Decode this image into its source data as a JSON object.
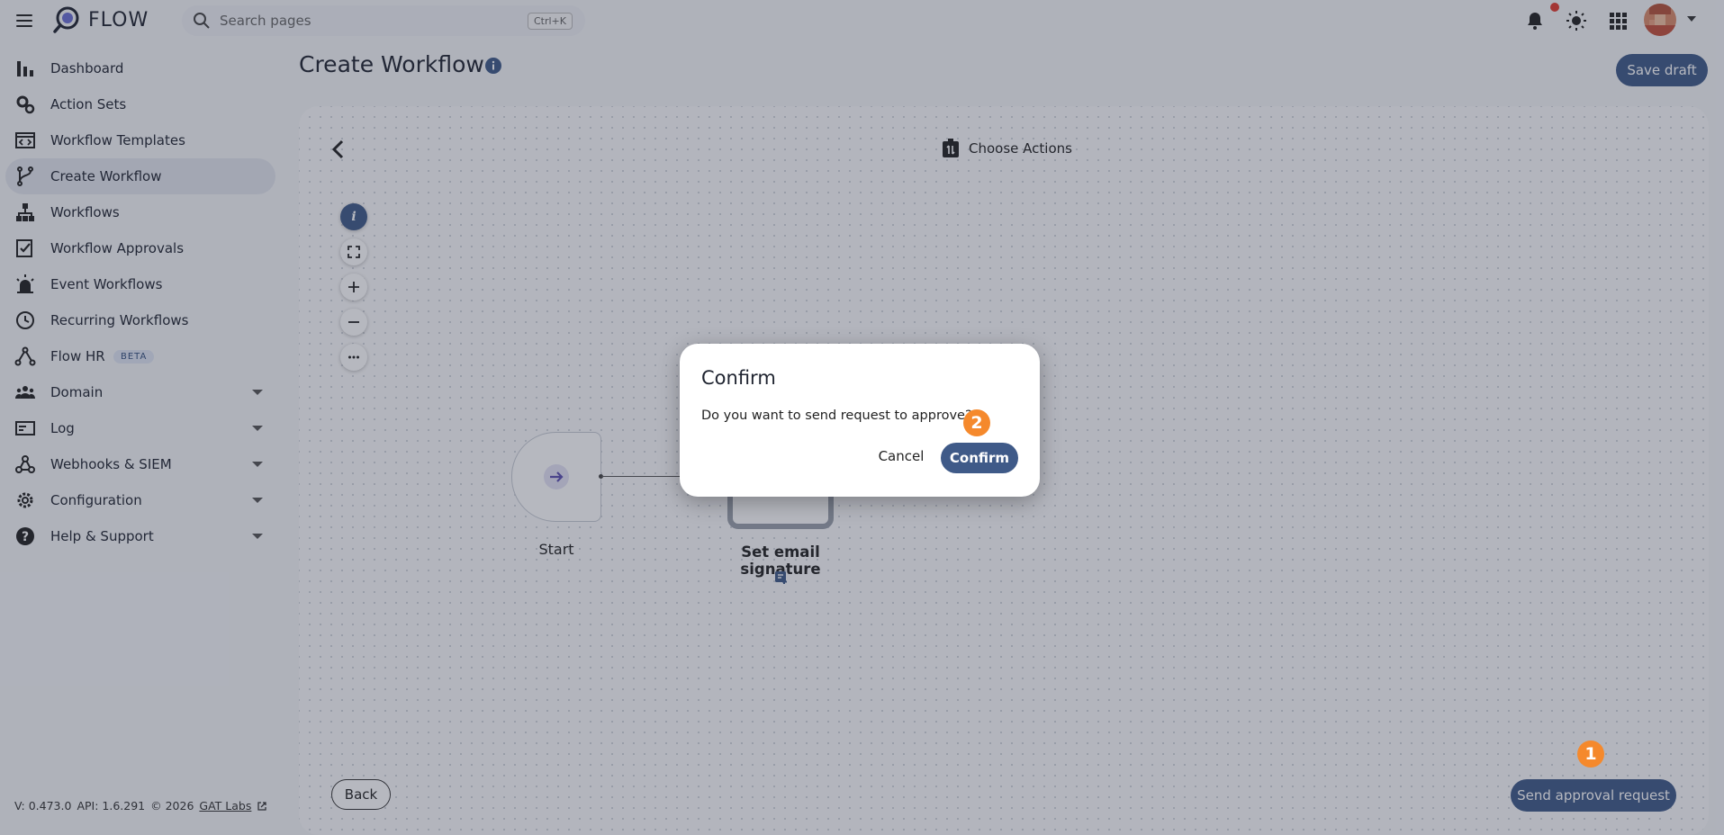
{
  "app": {
    "name": "FLOW"
  },
  "search": {
    "placeholder": "Search pages",
    "shortcut": "Ctrl+K"
  },
  "header": {
    "icons": [
      "bell-icon",
      "theme-sun-icon",
      "apps-grid-icon"
    ],
    "notification_dot_color": "#e23b2e"
  },
  "sidebar": {
    "items": [
      {
        "label": "Dashboard",
        "icon": "bar-chart-icon"
      },
      {
        "label": "Action Sets",
        "icon": "gears-icon"
      },
      {
        "label": "Workflow Templates",
        "icon": "template-icon"
      },
      {
        "label": "Create Workflow",
        "icon": "branch-icon",
        "active": true
      },
      {
        "label": "Workflows",
        "icon": "hierarchy-icon"
      },
      {
        "label": "Workflow Approvals",
        "icon": "approval-icon"
      },
      {
        "label": "Event Workflows",
        "icon": "alarm-icon"
      },
      {
        "label": "Recurring Workflows",
        "icon": "clock-icon"
      },
      {
        "label": "Flow HR",
        "icon": "hr-icon",
        "badge": "BETA"
      },
      {
        "label": "Domain",
        "icon": "people-icon",
        "expandable": true
      },
      {
        "label": "Log",
        "icon": "log-icon",
        "expandable": true
      },
      {
        "label": "Webhooks & SIEM",
        "icon": "webhook-icon",
        "expandable": true
      },
      {
        "label": "Configuration",
        "icon": "settings-icon",
        "expandable": true
      },
      {
        "label": "Help & Support",
        "icon": "help-icon",
        "expandable": true
      }
    ]
  },
  "footer": {
    "version": "V: 0.473.0",
    "api": "API: 1.6.291",
    "copyright": "© 2026",
    "company": "GAT Labs"
  },
  "page": {
    "title": "Create Workflow",
    "save_draft_label": "Save draft"
  },
  "canvas": {
    "toolbar_title": "Choose Actions",
    "tools": [
      "info-icon",
      "fit-view-icon",
      "zoom-in-icon",
      "zoom-out-icon",
      "more-icon"
    ],
    "nodes": [
      {
        "label": "Start",
        "type": "start"
      },
      {
        "label": "Set email signature",
        "type": "action"
      }
    ],
    "back_label": "Back",
    "send_label": "Send approval request"
  },
  "dialog": {
    "title": "Confirm",
    "message": "Do you want to send request to approve?",
    "cancel_label": "Cancel",
    "confirm_label": "Confirm"
  },
  "annotations": [
    {
      "number": "1",
      "color": "#f5892c"
    },
    {
      "number": "2",
      "color": "#f5892c"
    }
  ],
  "colors": {
    "primary": "#3f5a88",
    "badge": "#f5892c"
  }
}
